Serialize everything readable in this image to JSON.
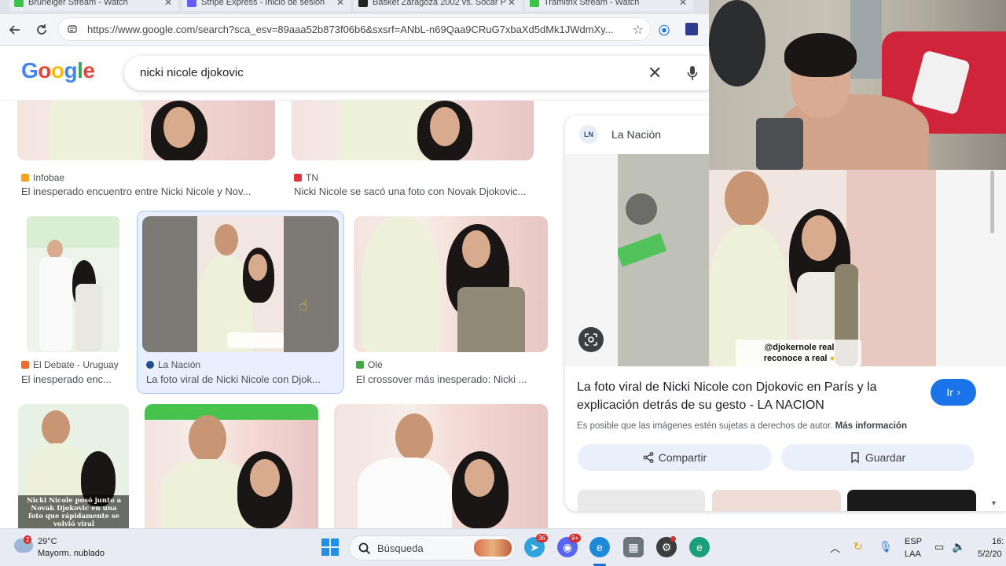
{
  "browser": {
    "tabs": [
      {
        "label": "Bruneiger Stream - Watch"
      },
      {
        "label": "Stripe Express - Inicio de sesión"
      },
      {
        "label": "Basket Zaragoza 2002 vs. Socar P"
      },
      {
        "label": "Tramitrix Stream - Watch"
      }
    ],
    "url": "https://www.google.com/search?sca_esv=89aaa52b873f06b6&sxsrf=ANbL-n69Qaa9CRuG7xbaXd5dMk1JWdmXy..."
  },
  "google": {
    "logo": "Google",
    "query": "nicki nicole djokovic"
  },
  "results": [
    {
      "source": "Infobae",
      "title": "El inesperado encuentro entre Nicki Nicole y Nov...",
      "icon_color": "#f6a21c"
    },
    {
      "source": "TN",
      "title": "Nicki Nicole se sacó una foto con Novak Djokovic...",
      "icon_color": "#e2333a"
    },
    {
      "source": "El Debate - Uruguay",
      "title": "El inesperado enc...",
      "icon_color": "#f06a2a"
    },
    {
      "source": "La Nación",
      "title": "La foto viral de Nicki Nicole con Djok...",
      "icon_color": "#1f4e8c"
    },
    {
      "source": "Olé",
      "title": "El crossover más inesperado: Nicki ...",
      "icon_color": "#45a845"
    }
  ],
  "thumb_caption": "Nicki Nicole posó junto a Novak Djokovic en una foto que rápidamente se volvió viral",
  "panel": {
    "source": "La Nación",
    "source_logo": "LN",
    "overlay_line1": "@djokernole real",
    "overlay_line2": "reconoce a real",
    "title": "La foto viral de Nicki Nicole con Djokovic en París y la explicación detrás de su gesto - LA NACION",
    "go_button": "Ir",
    "copyright": "Es posible que las imágenes estén sujetas a derechos de autor.",
    "more_info": "Más información",
    "share": "Compartir",
    "save": "Guardar"
  },
  "taskbar": {
    "temperature": "29°C",
    "weather": "Mayorm. nublado",
    "weather_badge": "2",
    "search": "Búsqueda",
    "telegram_badge": "36",
    "discord_badge": "9+",
    "lang": "ESP",
    "region": "LAA",
    "time": "16:",
    "date": "5/2/20"
  },
  "colors": {
    "google_blue": "#4285f4",
    "google_red": "#ea4335",
    "google_yellow": "#fbbc05",
    "google_green": "#34a853",
    "selected_border": "#a8c7fa",
    "go_button": "#1a73e8"
  }
}
